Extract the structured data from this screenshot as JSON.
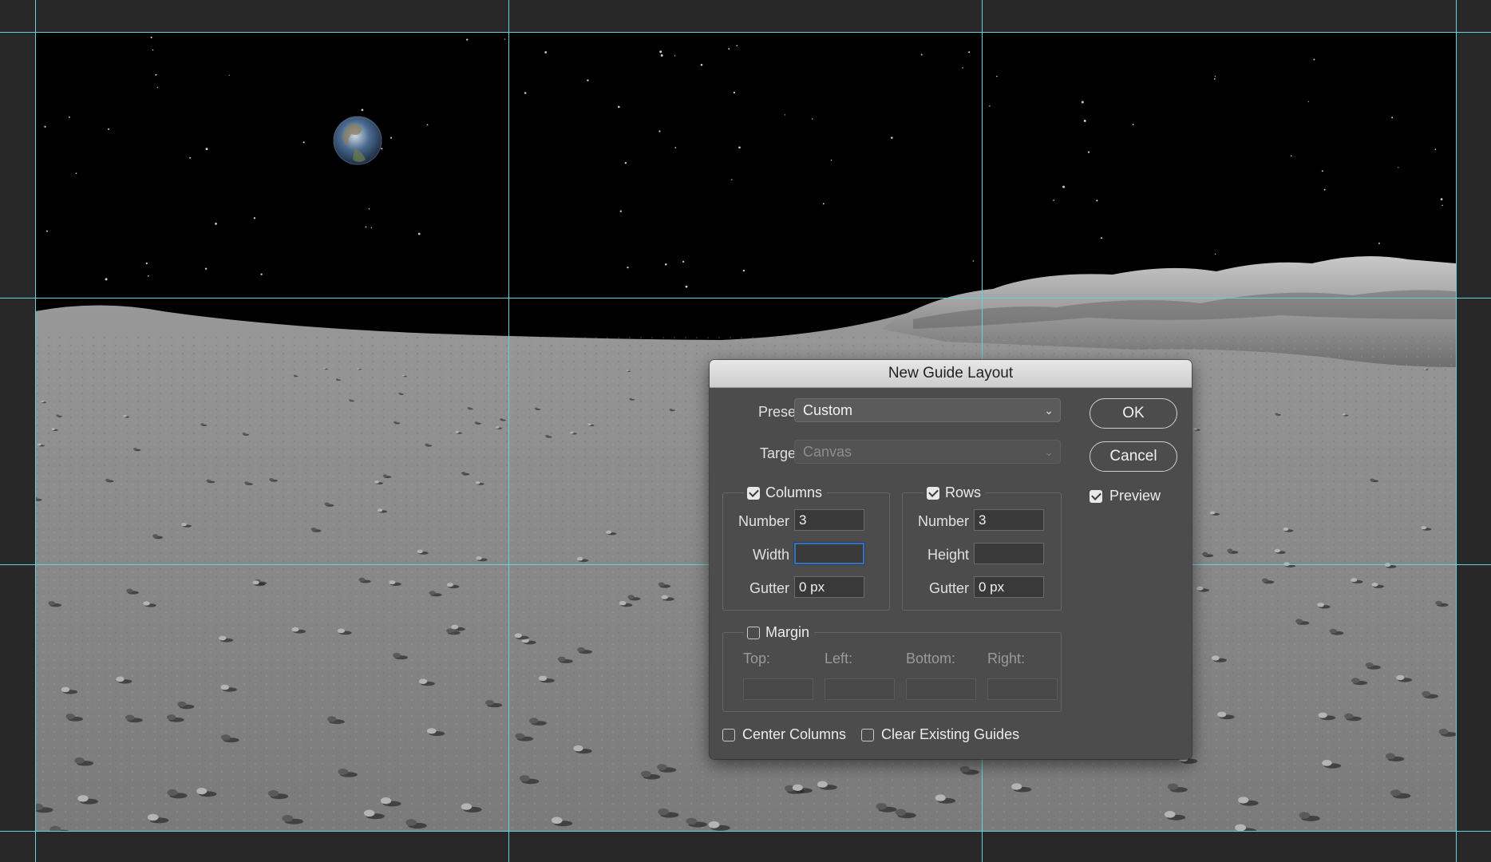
{
  "dialog": {
    "title": "New Guide Layout",
    "preset_label": "Preset:",
    "preset_value": "Custom",
    "target_label": "Target:",
    "target_value": "Canvas",
    "ok_label": "OK",
    "cancel_label": "Cancel",
    "preview_label": "Preview",
    "preview_checked": true,
    "columns": {
      "label": "Columns",
      "checked": true,
      "number_label": "Number",
      "number_value": "3",
      "width_label": "Width",
      "width_value": "",
      "gutter_label": "Gutter",
      "gutter_value": "0 px"
    },
    "rows": {
      "label": "Rows",
      "checked": true,
      "number_label": "Number",
      "number_value": "3",
      "height_label": "Height",
      "height_value": "",
      "gutter_label": "Gutter",
      "gutter_value": "0 px"
    },
    "margin": {
      "label": "Margin",
      "checked": false,
      "top_label": "Top:",
      "left_label": "Left:",
      "bottom_label": "Bottom:",
      "right_label": "Right:"
    },
    "center_columns_label": "Center Columns",
    "center_columns_checked": false,
    "clear_guides_label": "Clear Existing Guides",
    "clear_guides_checked": false
  },
  "colors": {
    "guide": "#5fd4dc",
    "workspace": "#282828",
    "dialog_bg": "#4c4c4c",
    "focus_ring": "#3d6fb8"
  }
}
